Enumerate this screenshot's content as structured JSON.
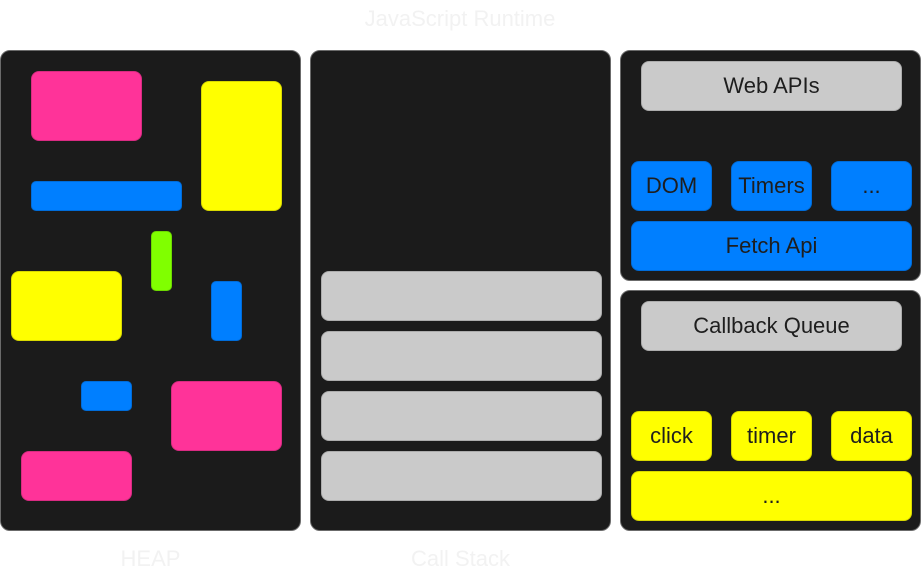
{
  "title": "JavaScript Runtime",
  "colors": {
    "panel_bg": "#1b1b1b",
    "pink": "#ff3399",
    "yellow": "#ffff00",
    "blue": "#007fff",
    "green": "#80ff00",
    "gray": "#cacaca",
    "caption": "#f2f2f2",
    "text": "#1e1e1e"
  },
  "heap": {
    "label": "HEAP",
    "objects": [
      {
        "kind": "pink"
      },
      {
        "kind": "yellow"
      },
      {
        "kind": "blue"
      },
      {
        "kind": "green"
      },
      {
        "kind": "yellow"
      },
      {
        "kind": "blue"
      },
      {
        "kind": "blue"
      },
      {
        "kind": "pink"
      },
      {
        "kind": "pink"
      }
    ]
  },
  "call_stack": {
    "label": "Call Stack",
    "frames": [
      "",
      "",
      "",
      ""
    ]
  },
  "web_apis": {
    "title": "Web APIs",
    "items": [
      "DOM",
      "Timers",
      "...",
      "Fetch Api"
    ]
  },
  "callback_queue": {
    "title": "Callback Queue",
    "items": [
      "click",
      "timer",
      "data",
      "..."
    ]
  }
}
